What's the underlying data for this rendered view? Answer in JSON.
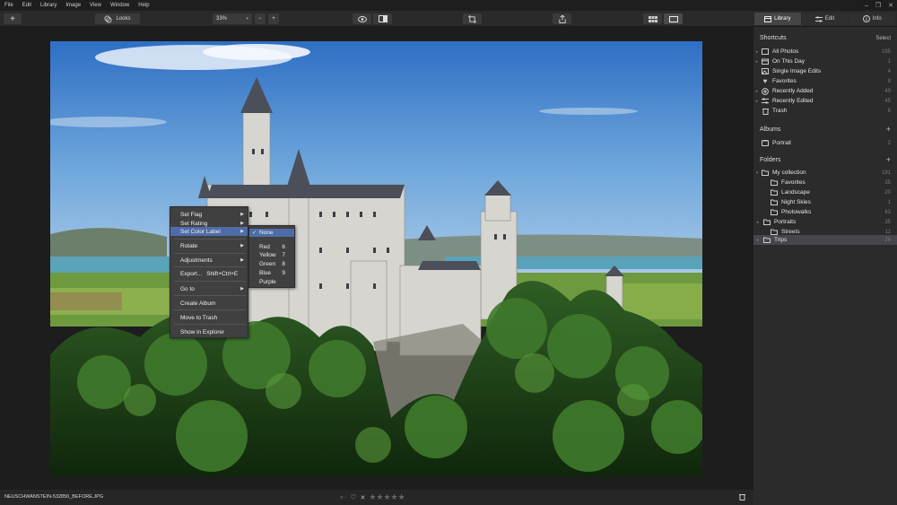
{
  "menubar": {
    "items": [
      "File",
      "Edit",
      "Library",
      "Image",
      "View",
      "Window",
      "Help"
    ]
  },
  "toolbar": {
    "looks_label": "Looks",
    "zoom_value": "33%",
    "zoom_minus": "−",
    "zoom_plus": "+"
  },
  "tabs": {
    "library": "Library",
    "edit": "Edit",
    "info": "Info"
  },
  "sidebar": {
    "shortcuts_title": "Shortcuts",
    "select_label": "Select",
    "shortcuts": [
      {
        "label": "All Photos",
        "count": "195",
        "icon": "photo-icon"
      },
      {
        "label": "On This Day",
        "count": "1",
        "icon": "calendar-icon"
      },
      {
        "label": "Single Image Edits",
        "count": "4",
        "icon": "image-edit-icon"
      },
      {
        "label": "Favorites",
        "count": "9",
        "icon": "heart-icon"
      },
      {
        "label": "Recently Added",
        "count": "49",
        "icon": "recent-added-icon"
      },
      {
        "label": "Recently Edited",
        "count": "45",
        "icon": "recent-edited-icon"
      },
      {
        "label": "Trash",
        "count": "6",
        "icon": "trash-icon"
      }
    ],
    "albums_title": "Albums",
    "albums": [
      {
        "label": "Portrait",
        "count": "2"
      }
    ],
    "folders_title": "Folders",
    "folders": [
      {
        "label": "My collection",
        "count": "191"
      },
      {
        "label": "Favorites",
        "count": "35"
      },
      {
        "label": "Landscape",
        "count": "20"
      },
      {
        "label": "Night Skies",
        "count": "1"
      },
      {
        "label": "Photowalks",
        "count": "63"
      },
      {
        "label": "Portraits",
        "count": "35"
      },
      {
        "label": "Streets",
        "count": "11"
      },
      {
        "label": "Trips",
        "count": "26"
      }
    ]
  },
  "statusbar": {
    "filename": "NEUSCHWANSTEIN-532850_BEFORE.JPG",
    "flag": "○ ·",
    "stars": "★★★★★"
  },
  "context_menu": {
    "items": [
      {
        "label": "Set Flag",
        "sub": "▶"
      },
      {
        "label": "Set Rating",
        "sub": "▶"
      },
      {
        "label": "Set Color Label",
        "sub": "▶"
      },
      {
        "label": "Rotate",
        "sub": "▶"
      },
      {
        "label": "Adjustments",
        "sub": "▶"
      },
      {
        "label": "Export...",
        "shortcut": "Shift+Ctrl+E"
      },
      {
        "label": "Go to",
        "sub": "▶"
      },
      {
        "label": "Create Album"
      },
      {
        "label": "Move to Trash"
      },
      {
        "label": "Show in Explorer"
      }
    ]
  },
  "color_submenu": {
    "items": [
      {
        "label": "None",
        "check": "✓"
      },
      {
        "label": "Red",
        "num": "6"
      },
      {
        "label": "Yellow",
        "num": "7"
      },
      {
        "label": "Green",
        "num": "8"
      },
      {
        "label": "Blue",
        "num": "9"
      },
      {
        "label": "Purple"
      }
    ]
  },
  "colors": {
    "accent": "#4e6da8",
    "selected_row": "#45474d",
    "sidebar_bg": "#2b2b2b"
  }
}
